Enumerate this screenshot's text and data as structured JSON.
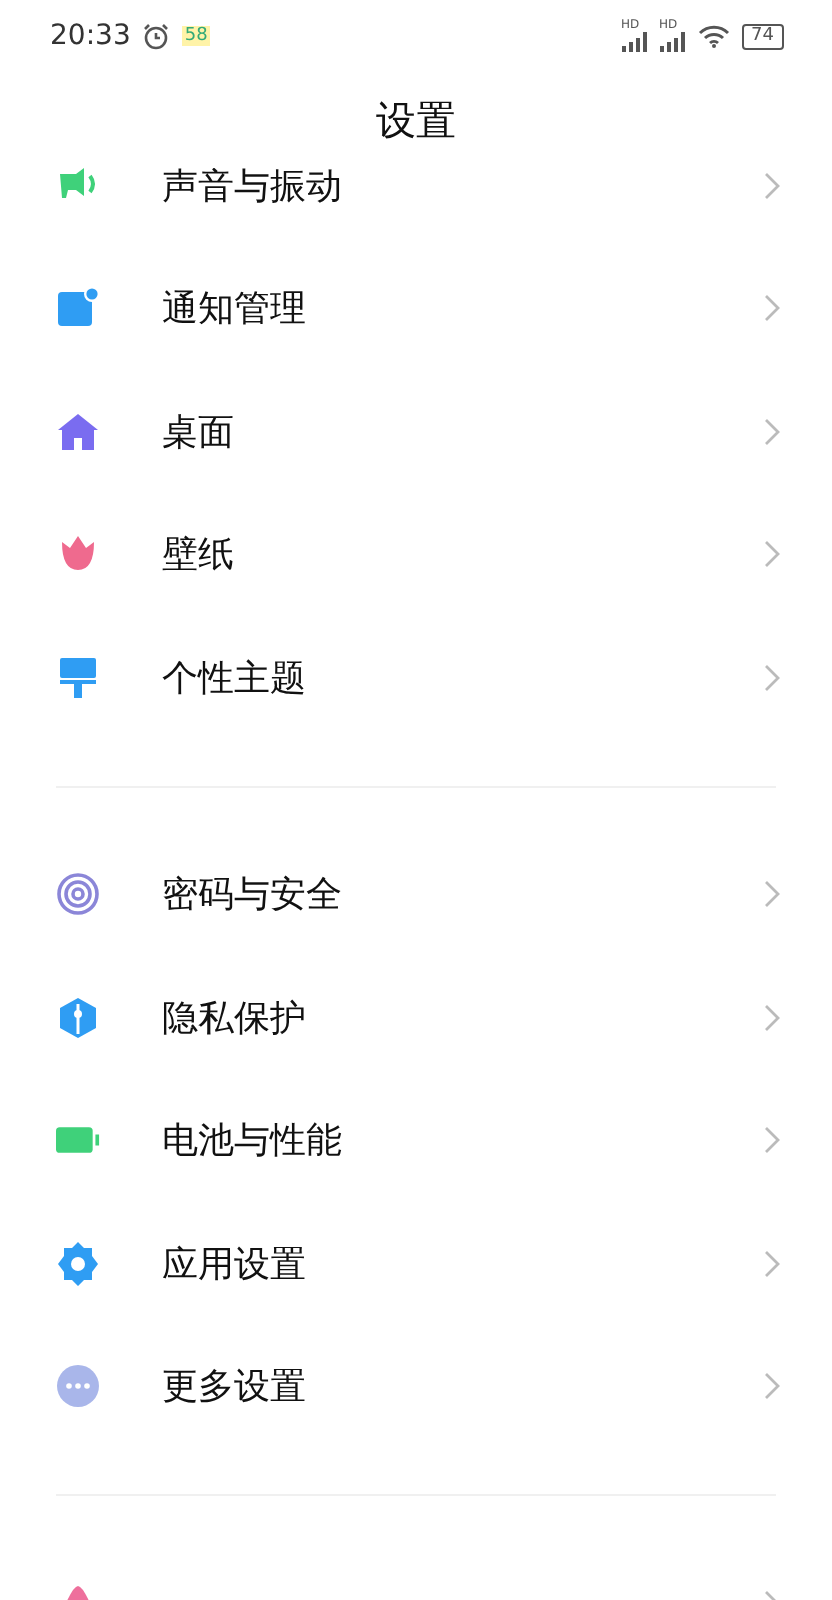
{
  "status_bar": {
    "time": "20:33",
    "notification_badge": "58",
    "signal_labels": [
      "HD",
      "HD"
    ],
    "battery": "74"
  },
  "title": "设置",
  "groups": [
    {
      "items": [
        {
          "kind": "sound",
          "label": "声音与振动"
        },
        {
          "kind": "notification",
          "label": "通知管理"
        },
        {
          "kind": "home",
          "label": "桌面"
        },
        {
          "kind": "wallpaper",
          "label": "壁纸"
        },
        {
          "kind": "theme",
          "label": "个性主题"
        }
      ]
    },
    {
      "items": [
        {
          "kind": "security",
          "label": "密码与安全"
        },
        {
          "kind": "privacy",
          "label": "隐私保护"
        },
        {
          "kind": "battery",
          "label": "电池与性能"
        },
        {
          "kind": "apps",
          "label": "应用设置"
        },
        {
          "kind": "more",
          "label": "更多设置"
        }
      ]
    },
    {
      "items": [
        {
          "kind": "assistant"
        }
      ]
    }
  ]
}
